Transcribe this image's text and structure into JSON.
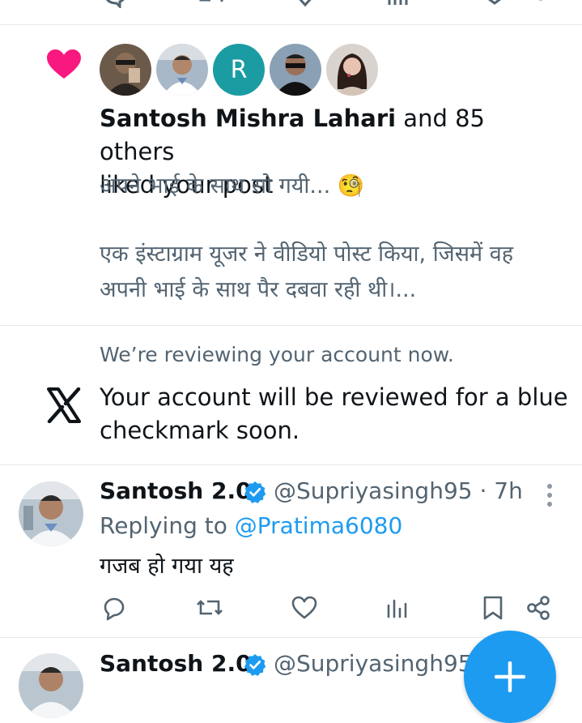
{
  "colors": {
    "accent": "#1d9bf0",
    "heart": "#f91880",
    "text_primary": "#0f1419",
    "text_secondary": "#536471",
    "divider": "#e6e8ea"
  },
  "like_notification": {
    "icon": "heart-icon",
    "avatars": [
      {
        "label": "",
        "icon": "avatar-photo"
      },
      {
        "label": "",
        "icon": "avatar-photo"
      },
      {
        "label": "R",
        "icon": "avatar-initial"
      },
      {
        "label": "",
        "icon": "avatar-photo"
      },
      {
        "label": "",
        "icon": "avatar-photo"
      }
    ],
    "actor_name": "Santosh Mishra Lahari",
    "others_text": " and 85 others",
    "action_text": "liked your post",
    "post_line1": "अपने भाई के साथ सो गयी... 🧐",
    "post_line2": "एक इंस्टाग्राम यूजर ने वीडियो पोस्ट किया, जिसमें वह",
    "post_line3": "अपनी भाई के साथ पैर दबवा रही थी।..."
  },
  "review_notification": {
    "icon": "x-logo-icon",
    "subtitle": "We’re reviewing your account now.",
    "message_line1": "Your account will be reviewed for a blue",
    "message_line2": "checkmark soon."
  },
  "tweets": [
    {
      "name": "Santosh 2.0",
      "handle": "@Supriyasingh95 · 7h",
      "replying_prefix": "Replying to ",
      "replying_to": "@Pratima6080",
      "text": "गजब हो गया यह"
    },
    {
      "name": "Santosh 2.0",
      "handle": "@Supriyasingh95"
    }
  ],
  "fab": {
    "icon": "plus-icon"
  }
}
